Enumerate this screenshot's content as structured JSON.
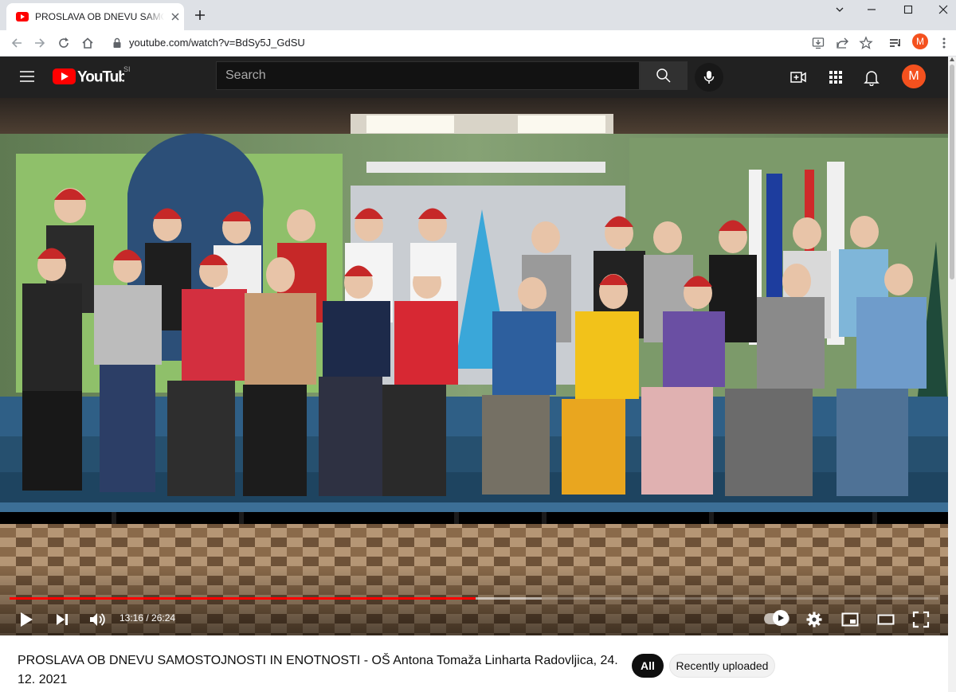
{
  "browser": {
    "tab_title": "PROSLAVA OB DNEVU SAMOSTOJNOSTI IN ENOTNOSTI - OŠ Antona Tomaža Linharta Radovljica",
    "url": "youtube.com/watch?v=BdSy5J_GdSU",
    "profile_initial": "M",
    "icons": [
      "youtube-favicon",
      "close-icon",
      "plus-icon",
      "chevron-down-icon",
      "minimize-icon",
      "maximize-icon",
      "window-close-icon",
      "back-arrow-icon",
      "forward-arrow-icon",
      "reload-icon",
      "home-icon",
      "lock-icon",
      "install-icon",
      "share-icon",
      "star-icon",
      "reading-list-icon",
      "kebab-menu-icon"
    ]
  },
  "youtube": {
    "logo_text": "YouTube",
    "country_code": "SI",
    "search_placeholder": "Search",
    "profile_initial": "M",
    "icons": [
      "hamburger-menu-icon",
      "search-icon",
      "microphone-icon",
      "create-video-icon",
      "apps-grid-icon",
      "notifications-bell-icon"
    ]
  },
  "player": {
    "current_time": "13:16",
    "duration": "26:24",
    "time_display": "13:16 / 26:24",
    "played_fraction": 0.502,
    "buffered_fraction": 0.573,
    "icons": [
      "play-icon",
      "next-icon",
      "volume-icon",
      "autoplay-toggle-icon",
      "settings-gear-icon",
      "miniplayer-icon",
      "theater-mode-icon",
      "fullscreen-icon"
    ],
    "colors": {
      "progress": "#ff0000"
    }
  },
  "video": {
    "title": "PROSLAVA OB DNEVU SAMOSTOJNOSTI IN ENOTNOSTI - OŠ Antona Tomaža Linharta Radovljica, 24. 12. 2021"
  },
  "chips": [
    {
      "label": "All",
      "selected": true
    },
    {
      "label": "Recently uploaded",
      "selected": false
    }
  ]
}
